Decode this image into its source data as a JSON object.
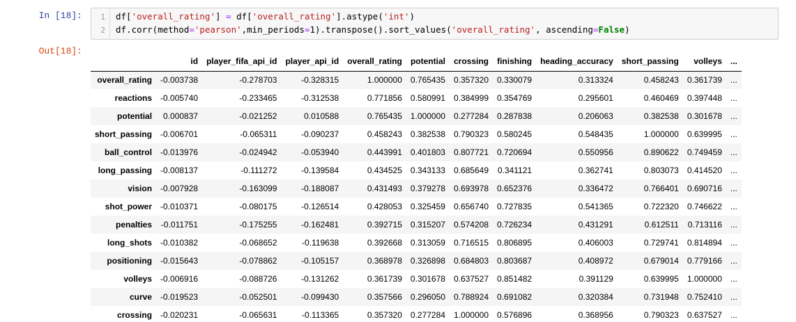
{
  "cell": {
    "in_prompt": "In [18]:",
    "out_prompt": "Out[18]:",
    "line_numbers": [
      "1",
      "2"
    ]
  },
  "code": {
    "line1": [
      {
        "t": "df[",
        "c": ""
      },
      {
        "t": "'overall_rating'",
        "c": "tok-str"
      },
      {
        "t": "] ",
        "c": ""
      },
      {
        "t": "=",
        "c": "tok-op"
      },
      {
        "t": " df[",
        "c": ""
      },
      {
        "t": "'overall_rating'",
        "c": "tok-str"
      },
      {
        "t": "].astype(",
        "c": ""
      },
      {
        "t": "'int'",
        "c": "tok-str"
      },
      {
        "t": ")",
        "c": ""
      }
    ],
    "line2": [
      {
        "t": "df.corr(method",
        "c": ""
      },
      {
        "t": "=",
        "c": "tok-op"
      },
      {
        "t": "'pearson'",
        "c": "tok-str"
      },
      {
        "t": ",min_periods",
        "c": ""
      },
      {
        "t": "=",
        "c": "tok-op"
      },
      {
        "t": "1).transpose().sort_values(",
        "c": ""
      },
      {
        "t": "'overall_rating'",
        "c": "tok-str"
      },
      {
        "t": ", ascending",
        "c": ""
      },
      {
        "t": "=",
        "c": "tok-op"
      },
      {
        "t": "False",
        "c": "tok-kw"
      },
      {
        "t": ")",
        "c": ""
      }
    ]
  },
  "table": {
    "columns": [
      "",
      "id",
      "player_fifa_api_id",
      "player_api_id",
      "overall_rating",
      "potential",
      "crossing",
      "finishing",
      "heading_accuracy",
      "short_passing",
      "volleys",
      "..."
    ],
    "rows": [
      {
        "index": "overall_rating",
        "values": [
          "-0.003738",
          "-0.278703",
          "-0.328315",
          "1.000000",
          "0.765435",
          "0.357320",
          "0.330079",
          "0.313324",
          "0.458243",
          "0.361739",
          "..."
        ]
      },
      {
        "index": "reactions",
        "values": [
          "-0.005740",
          "-0.233465",
          "-0.312538",
          "0.771856",
          "0.580991",
          "0.384999",
          "0.354769",
          "0.295601",
          "0.460469",
          "0.397448",
          "..."
        ]
      },
      {
        "index": "potential",
        "values": [
          "0.000837",
          "-0.021252",
          "0.010588",
          "0.765435",
          "1.000000",
          "0.277284",
          "0.287838",
          "0.206063",
          "0.382538",
          "0.301678",
          "..."
        ]
      },
      {
        "index": "short_passing",
        "values": [
          "-0.006701",
          "-0.065311",
          "-0.090237",
          "0.458243",
          "0.382538",
          "0.790323",
          "0.580245",
          "0.548435",
          "1.000000",
          "0.639995",
          "..."
        ]
      },
      {
        "index": "ball_control",
        "values": [
          "-0.013976",
          "-0.024942",
          "-0.053940",
          "0.443991",
          "0.401803",
          "0.807721",
          "0.720694",
          "0.550956",
          "0.890622",
          "0.749459",
          "..."
        ]
      },
      {
        "index": "long_passing",
        "values": [
          "-0.008137",
          "-0.111272",
          "-0.139584",
          "0.434525",
          "0.343133",
          "0.685649",
          "0.341121",
          "0.362741",
          "0.803073",
          "0.414520",
          "..."
        ]
      },
      {
        "index": "vision",
        "values": [
          "-0.007928",
          "-0.163099",
          "-0.188087",
          "0.431493",
          "0.379278",
          "0.693978",
          "0.652376",
          "0.336472",
          "0.766401",
          "0.690716",
          "..."
        ]
      },
      {
        "index": "shot_power",
        "values": [
          "-0.010371",
          "-0.080175",
          "-0.126514",
          "0.428053",
          "0.325459",
          "0.656740",
          "0.727835",
          "0.541365",
          "0.722320",
          "0.746622",
          "..."
        ]
      },
      {
        "index": "penalties",
        "values": [
          "-0.011751",
          "-0.175255",
          "-0.162481",
          "0.392715",
          "0.315207",
          "0.574208",
          "0.726234",
          "0.431291",
          "0.612511",
          "0.713116",
          "..."
        ]
      },
      {
        "index": "long_shots",
        "values": [
          "-0.010382",
          "-0.068652",
          "-0.119638",
          "0.392668",
          "0.313059",
          "0.716515",
          "0.806895",
          "0.406003",
          "0.729741",
          "0.814894",
          "..."
        ]
      },
      {
        "index": "positioning",
        "values": [
          "-0.015643",
          "-0.078862",
          "-0.105157",
          "0.368978",
          "0.326898",
          "0.684803",
          "0.803687",
          "0.408972",
          "0.679014",
          "0.779166",
          "..."
        ]
      },
      {
        "index": "volleys",
        "values": [
          "-0.006916",
          "-0.088726",
          "-0.131262",
          "0.361739",
          "0.301678",
          "0.637527",
          "0.851482",
          "0.391129",
          "0.639995",
          "1.000000",
          "..."
        ]
      },
      {
        "index": "curve",
        "values": [
          "-0.019523",
          "-0.052501",
          "-0.099430",
          "0.357566",
          "0.296050",
          "0.788924",
          "0.691082",
          "0.320384",
          "0.731948",
          "0.752410",
          "..."
        ]
      },
      {
        "index": "crossing",
        "values": [
          "-0.020231",
          "-0.065631",
          "-0.113365",
          "0.357320",
          "0.277284",
          "1.000000",
          "0.576896",
          "0.368956",
          "0.790323",
          "0.637527",
          "..."
        ]
      }
    ]
  }
}
